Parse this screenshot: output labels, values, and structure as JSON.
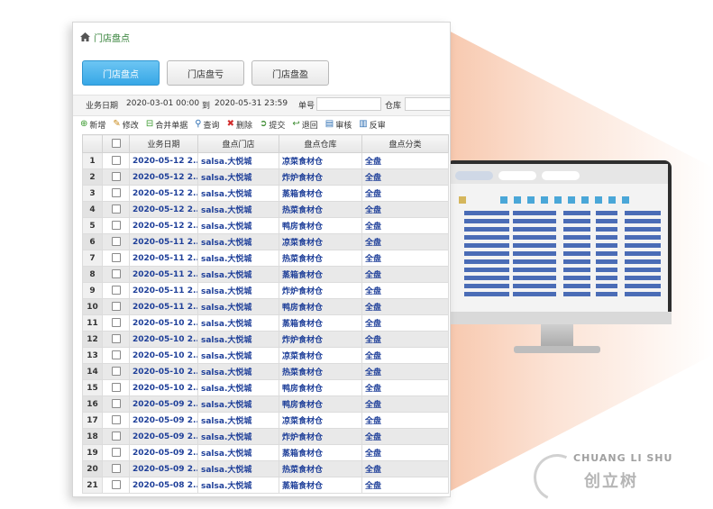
{
  "breadcrumb": {
    "icon": "home-icon",
    "title": "门店盘点"
  },
  "tabs": [
    {
      "label": "门店盘点",
      "active": true
    },
    {
      "label": "门店盘亏",
      "active": false
    },
    {
      "label": "门店盘盈",
      "active": false
    }
  ],
  "filter": {
    "date_label": "业务日期",
    "date_from": "2020-03-01 00:00",
    "to_label": "到",
    "date_to": "2020-05-31 23:59",
    "order_label": "单号",
    "order_value": "",
    "warehouse_label": "仓库",
    "warehouse_value": ""
  },
  "toolbar": [
    {
      "icon": "add-circle-icon",
      "label": "新增"
    },
    {
      "icon": "pencil-icon",
      "label": "修改"
    },
    {
      "icon": "merge-icon",
      "label": "合并单据"
    },
    {
      "icon": "search-icon",
      "label": "查询"
    },
    {
      "icon": "delete-x-icon",
      "label": "删除"
    },
    {
      "icon": "submit-icon",
      "label": "提交"
    },
    {
      "icon": "return-icon",
      "label": "退回"
    },
    {
      "icon": "audit-icon",
      "label": "审核"
    },
    {
      "icon": "unaudit-icon",
      "label": "反审"
    }
  ],
  "table": {
    "columns": [
      "",
      "",
      "业务日期",
      "盘点门店",
      "盘点仓库",
      "盘点分类"
    ],
    "rows": [
      [
        "1",
        "2020-05-12 2...",
        "salsa.大悦城",
        "凉菜食材仓",
        "全盘"
      ],
      [
        "2",
        "2020-05-12 2...",
        "salsa.大悦城",
        "炸炉食材仓",
        "全盘"
      ],
      [
        "3",
        "2020-05-12 2...",
        "salsa.大悦城",
        "蒸箱食材仓",
        "全盘"
      ],
      [
        "4",
        "2020-05-12 2...",
        "salsa.大悦城",
        "热菜食材仓",
        "全盘"
      ],
      [
        "5",
        "2020-05-12 2...",
        "salsa.大悦城",
        "鸭房食材仓",
        "全盘"
      ],
      [
        "6",
        "2020-05-11 2...",
        "salsa.大悦城",
        "凉菜食材仓",
        "全盘"
      ],
      [
        "7",
        "2020-05-11 2...",
        "salsa.大悦城",
        "热菜食材仓",
        "全盘"
      ],
      [
        "8",
        "2020-05-11 2...",
        "salsa.大悦城",
        "蒸箱食材仓",
        "全盘"
      ],
      [
        "9",
        "2020-05-11 2...",
        "salsa.大悦城",
        "炸炉食材仓",
        "全盘"
      ],
      [
        "10",
        "2020-05-11 2...",
        "salsa.大悦城",
        "鸭房食材仓",
        "全盘"
      ],
      [
        "11",
        "2020-05-10 2...",
        "salsa.大悦城",
        "蒸箱食材仓",
        "全盘"
      ],
      [
        "12",
        "2020-05-10 2...",
        "salsa.大悦城",
        "炸炉食材仓",
        "全盘"
      ],
      [
        "13",
        "2020-05-10 2...",
        "salsa.大悦城",
        "凉菜食材仓",
        "全盘"
      ],
      [
        "14",
        "2020-05-10 2...",
        "salsa.大悦城",
        "热菜食材仓",
        "全盘"
      ],
      [
        "15",
        "2020-05-10 2...",
        "salsa.大悦城",
        "鸭房食材仓",
        "全盘"
      ],
      [
        "16",
        "2020-05-09 2...",
        "salsa.大悦城",
        "鸭房食材仓",
        "全盘"
      ],
      [
        "17",
        "2020-05-09 2...",
        "salsa.大悦城",
        "凉菜食材仓",
        "全盘"
      ],
      [
        "18",
        "2020-05-09 2...",
        "salsa.大悦城",
        "炸炉食材仓",
        "全盘"
      ],
      [
        "19",
        "2020-05-09 2...",
        "salsa.大悦城",
        "蒸箱食材仓",
        "全盘"
      ],
      [
        "20",
        "2020-05-09 2...",
        "salsa.大悦城",
        "热菜食材仓",
        "全盘"
      ],
      [
        "21",
        "2020-05-08 2...",
        "salsa.大悦城",
        "蒸箱食材仓",
        "全盘"
      ]
    ]
  },
  "watermark": {
    "en": "CHUANG LI SHU",
    "cn": "创立树"
  },
  "colors": {
    "accent": "#37a7e6",
    "link_text": "#1e3f99",
    "breadcrumb": "#2e7d32",
    "beam": "#f7c4a8"
  }
}
